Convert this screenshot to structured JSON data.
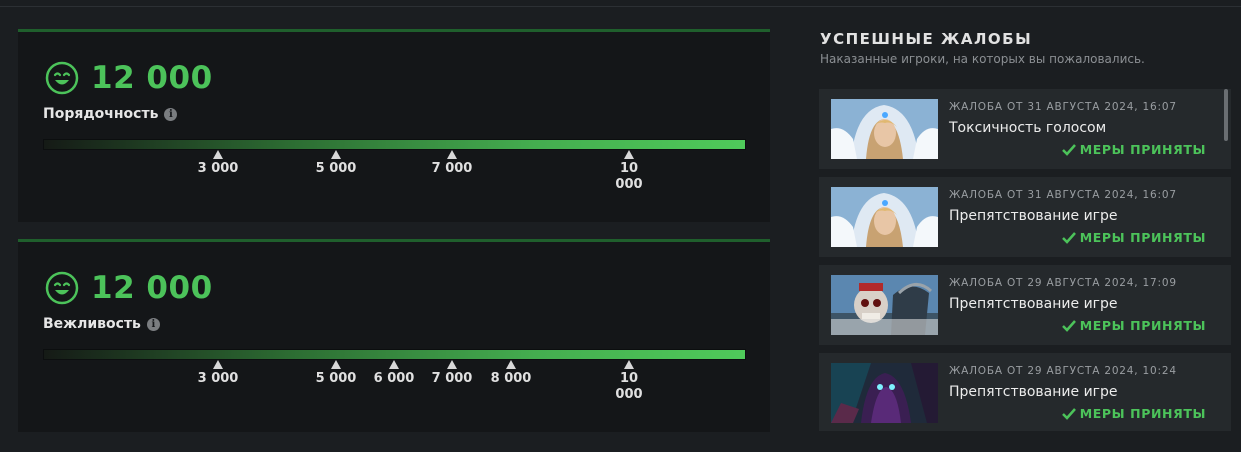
{
  "stats": [
    {
      "score": "12 000",
      "label": "Порядочность",
      "ticks": [
        {
          "value": 3000,
          "label": "3 000"
        },
        {
          "value": 5000,
          "label": "5 000"
        },
        {
          "value": 7000,
          "label": "7 000"
        },
        {
          "value": 10000,
          "label": "10 000"
        }
      ]
    },
    {
      "score": "12 000",
      "label": "Вежливость",
      "ticks": [
        {
          "value": 3000,
          "label": "3 000"
        },
        {
          "value": 5000,
          "label": "5 000"
        },
        {
          "value": 6000,
          "label": "6 000"
        },
        {
          "value": 7000,
          "label": "7 000"
        },
        {
          "value": 8000,
          "label": "8 000"
        },
        {
          "value": 10000,
          "label": "10 000"
        }
      ]
    }
  ],
  "reports_panel": {
    "title": "УСПЕШНЫЕ ЖАЛОБЫ",
    "subtitle": "Наказанные игроки, на которых вы пожаловались.",
    "items": [
      {
        "date": "ЖАЛОБА ОТ 31 АВГУСТА 2024, 16:07",
        "reason": "Токсичность голосом",
        "status": "МЕРЫ ПРИНЯТЫ",
        "hero_icon": "crystal-maiden-portrait"
      },
      {
        "date": "ЖАЛОБА ОТ 31 АВГУСТА 2024, 16:07",
        "reason": "Препятствование игре",
        "status": "МЕРЫ ПРИНЯТЫ",
        "hero_icon": "crystal-maiden-portrait"
      },
      {
        "date": "ЖАЛОБА ОТ 29 АВГУСТА 2024, 17:09",
        "reason": "Препятствование игре",
        "status": "МЕРЫ ПРИНЯТЫ",
        "hero_icon": "skeleton-hero-portrait"
      },
      {
        "date": "ЖАЛОБА ОТ 29 АВГУСТА 2024, 10:24",
        "reason": "Препятствование игре",
        "status": "МЕРЫ ПРИНЯТЫ",
        "hero_icon": "spectre-hero-portrait"
      }
    ]
  },
  "colors": {
    "accent_green": "#4cc35a",
    "panel_bg": "#141618",
    "page_bg": "#1b1e21",
    "card_bg": "#25292c"
  }
}
